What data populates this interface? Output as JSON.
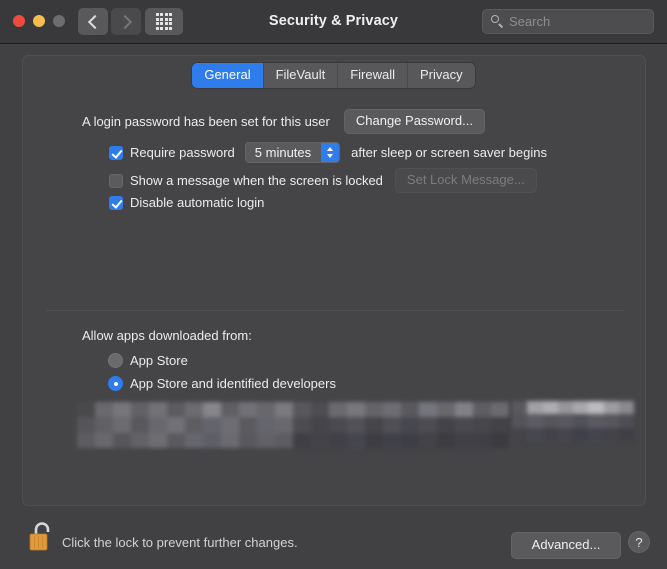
{
  "window": {
    "title": "Security & Privacy",
    "traffic_lights": [
      "close",
      "minimize",
      "zoom"
    ]
  },
  "toolbar": {
    "back_icon": "chevron-left-icon",
    "forward_icon": "chevron-right-icon",
    "grid_icon": "show-all-grid-icon",
    "search": {
      "placeholder": "Search",
      "value": "",
      "icon": "search-icon"
    }
  },
  "tabs": [
    {
      "label": "General",
      "active": true
    },
    {
      "label": "FileVault",
      "active": false
    },
    {
      "label": "Firewall",
      "active": false
    },
    {
      "label": "Privacy",
      "active": false
    }
  ],
  "general": {
    "password_status": "A login password has been set for this user",
    "change_password_label": "Change Password...",
    "require_password": {
      "label": "Require password",
      "checked": true,
      "delay_value": "5 minutes",
      "suffix": "after sleep or screen saver begins"
    },
    "show_message": {
      "label": "Show a message when the screen is locked",
      "checked": false,
      "button_label": "Set Lock Message...",
      "button_disabled": true
    },
    "disable_auto_login": {
      "label": "Disable automatic login",
      "checked": true
    }
  },
  "allow_apps": {
    "heading": "Allow apps downloaded from:",
    "options": [
      {
        "label": "App Store",
        "selected": false
      },
      {
        "label": "App Store and identified developers",
        "selected": true
      }
    ],
    "highlight_color": "#ee2200",
    "redacted_note": "blurred content"
  },
  "footer": {
    "lock_icon": "unlocked-padlock-icon",
    "lock_message": "Click the lock to prevent further changes.",
    "advanced_label": "Advanced...",
    "help_label": "?"
  },
  "colors": {
    "accent": "#2f7ced",
    "window_bg": "#414144",
    "panel_bg": "#454548",
    "titlebar_bg": "#39393b",
    "lock_gold": "#e09a3a"
  }
}
